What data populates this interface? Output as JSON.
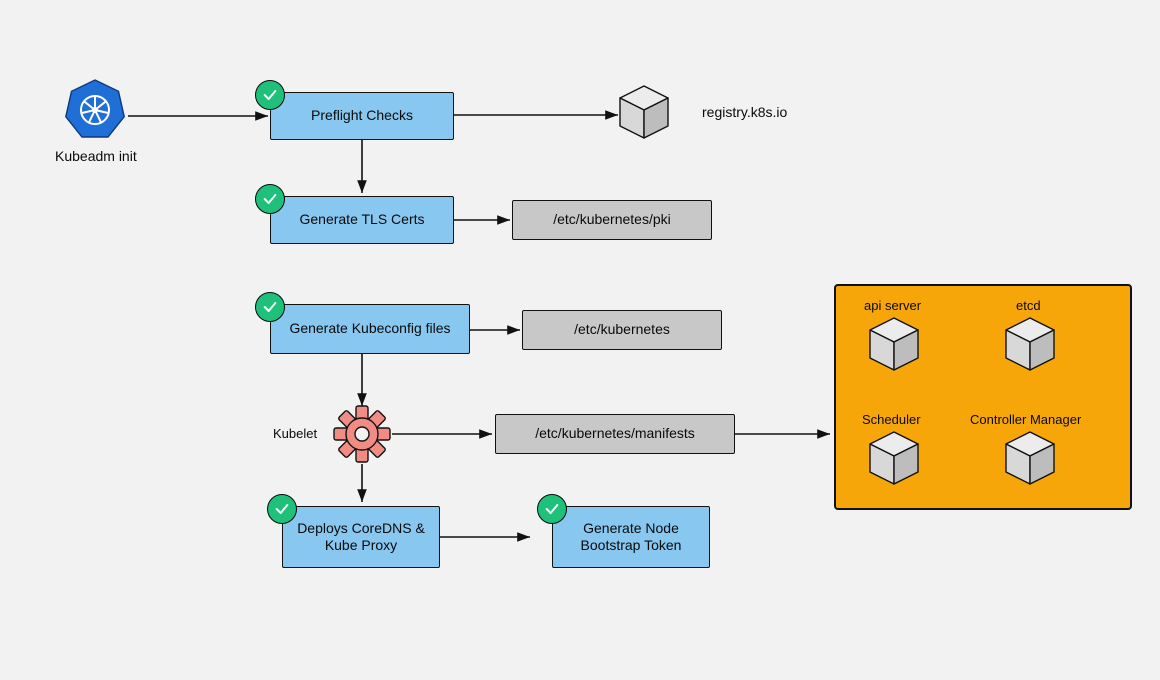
{
  "title_label": "Kubeadm init",
  "steps": {
    "preflight": "Preflight Checks",
    "tls": "Generate TLS Certs",
    "kubeconfig": "Generate Kubeconfig files",
    "deploys": "Deploys CoreDNS & Kube Proxy",
    "bootstrap": "Generate Node Bootstrap Token"
  },
  "outputs": {
    "registry_label": "registry.k8s.io",
    "pki_path": "/etc/kubernetes/pki",
    "etc_path": "/etc/kubernetes",
    "manifests_path": "/etc/kubernetes/manifests"
  },
  "kubelet_label": "Kubelet",
  "orange": {
    "api_server": "api server",
    "etcd": "etcd",
    "scheduler": "Scheduler",
    "controller_manager": "Controller Manager"
  },
  "colors": {
    "bg": "#f2f2f2",
    "blue": "#87c7f0",
    "grey": "#c8c8c8",
    "orange": "#f7a60a",
    "green": "#1ec07a",
    "gear": "#f08c84",
    "k8s": "#1f6fd6"
  }
}
